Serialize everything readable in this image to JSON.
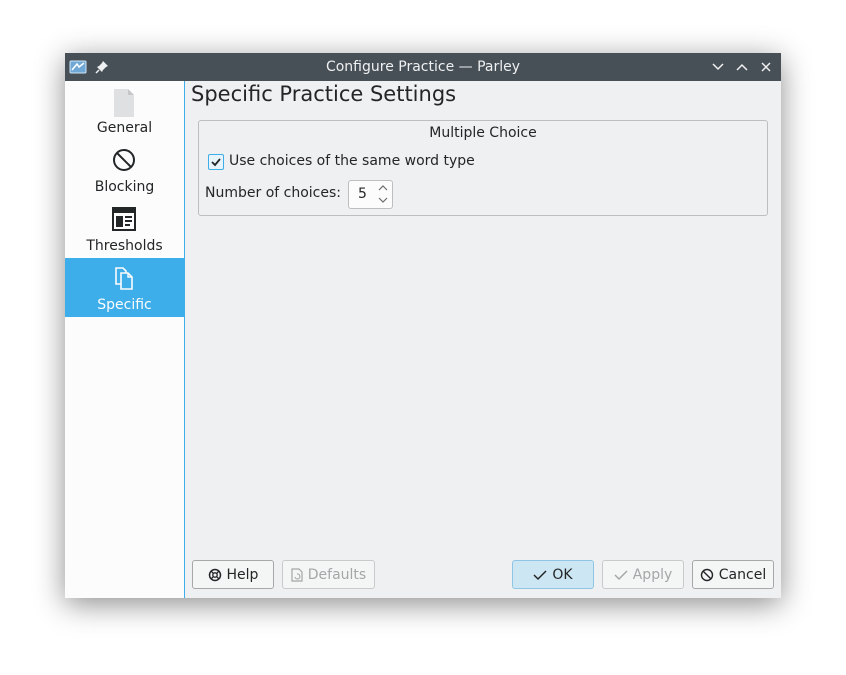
{
  "window": {
    "title": "Configure Practice — Parley"
  },
  "titlebar": {
    "icons": [
      "app-menu-icon",
      "pin-icon",
      "minimize-icon",
      "maximize-icon",
      "close-icon"
    ]
  },
  "sidebar": {
    "items": [
      {
        "label": "General",
        "icon": "document-icon",
        "active": false
      },
      {
        "label": "Blocking",
        "icon": "blocking-icon",
        "active": false
      },
      {
        "label": "Thresholds",
        "icon": "thresholds-icon",
        "active": false
      },
      {
        "label": "Specific",
        "icon": "copy-icon",
        "active": true
      }
    ]
  },
  "main": {
    "page_title": "Specific Practice Settings",
    "group": {
      "title": "Multiple Choice",
      "checkbox_label": "Use choices of the same word type",
      "checkbox_checked": true,
      "number_label": "Number of choices:",
      "number_value": "5"
    }
  },
  "buttons": {
    "help": "Help",
    "defaults": "Defaults",
    "ok": "OK",
    "apply": "Apply",
    "cancel": "Cancel"
  },
  "colors": {
    "accent": "#3daee9",
    "titlebar": "#475057",
    "window_bg": "#eff0f1"
  }
}
